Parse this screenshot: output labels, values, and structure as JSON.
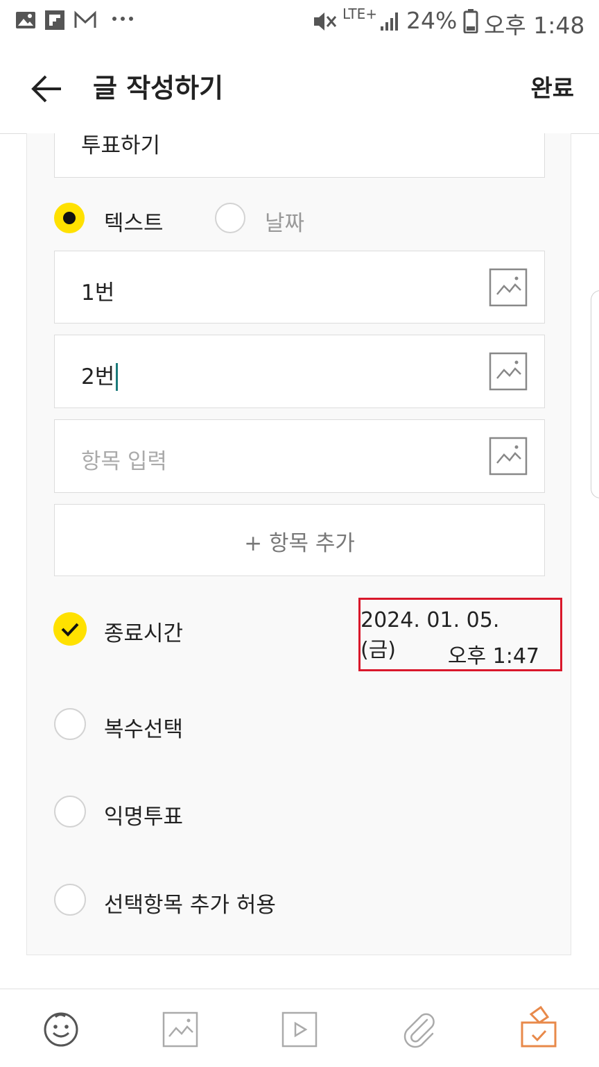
{
  "status_bar": {
    "battery": "24%",
    "time": "오후 1:48",
    "network": "LTE+",
    "icons": [
      "gallery-icon",
      "flipboard-icon",
      "gmail-icon",
      "more-icon",
      "mute-icon",
      "signal-icon",
      "battery-icon"
    ]
  },
  "header": {
    "title": "글 작성하기",
    "done_label": "완료",
    "back_icon": "back-arrow-icon"
  },
  "poll": {
    "title_value": "투표하기",
    "type_options": [
      {
        "label": "텍스트",
        "selected": true
      },
      {
        "label": "날짜",
        "selected": false
      }
    ],
    "items": [
      {
        "value": "1번",
        "placeholder": ""
      },
      {
        "value": "2번",
        "placeholder": ""
      },
      {
        "value": "",
        "placeholder": "항목 입력"
      }
    ],
    "add_item_label": "+ 항목 추가",
    "settings": [
      {
        "label": "종료시간",
        "checked": true
      },
      {
        "label": "복수선택",
        "checked": false
      },
      {
        "label": "익명투표",
        "checked": false
      },
      {
        "label": "선택항목 추가 허용",
        "checked": false
      }
    ],
    "end_time": {
      "date": "2024. 01. 05. (금)",
      "time": "오후 1:47"
    }
  },
  "toolbar": {
    "icons": [
      "emoticon-icon",
      "image-icon",
      "video-icon",
      "attachment-icon",
      "poll-icon"
    ]
  },
  "colors": {
    "accent_yellow": "#ffe100",
    "highlight_red": "#d9182b",
    "poll_orange": "#e8894a",
    "cursor_teal": "#1a7a7a"
  }
}
